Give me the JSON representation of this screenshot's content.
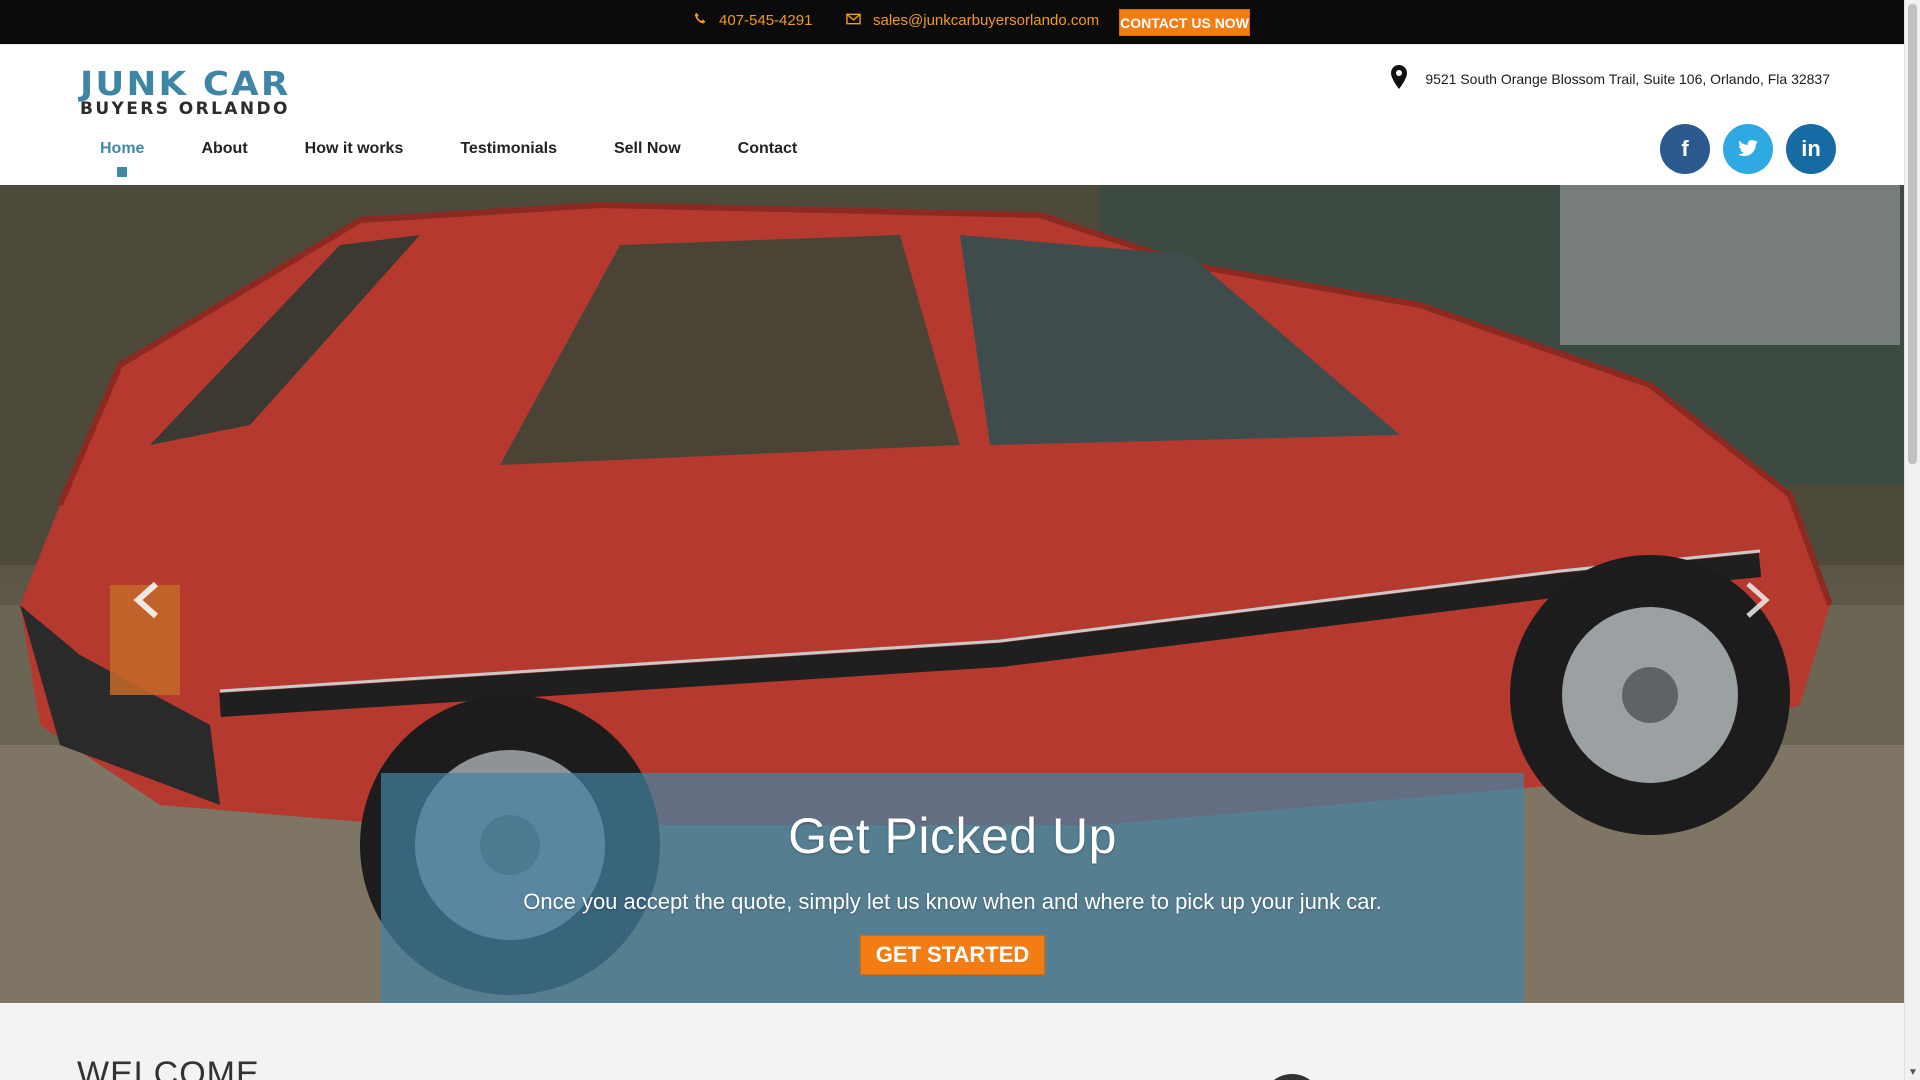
{
  "topbar": {
    "phone": "407-545-4291",
    "email": "sales@junkcarbuyersorlando.com",
    "contact_button": "CONTACT US NOW"
  },
  "header": {
    "logo_line1": "JUNK CAR",
    "logo_line2": "BUYERS ORLANDO",
    "address": "9521 South Orange Blossom Trail, Suite 106, Orlando, Fla 32837",
    "nav": [
      "Home",
      "About",
      "How it works",
      "Testimonials",
      "Sell Now",
      "Contact"
    ],
    "active_nav": "Home",
    "social": [
      "facebook-icon",
      "twitter-icon",
      "linkedin-icon"
    ]
  },
  "hero": {
    "title": "Get Picked Up",
    "text": "Once you accept the quote, simply let us know when and where to pick up your junk car.",
    "button": "GET STARTED"
  },
  "section": {
    "heading": "WELCOME"
  },
  "colors": {
    "accent_orange": "#f27d14",
    "brand_blue": "#3e86a6",
    "topbar_bg": "#0b0b0b"
  }
}
